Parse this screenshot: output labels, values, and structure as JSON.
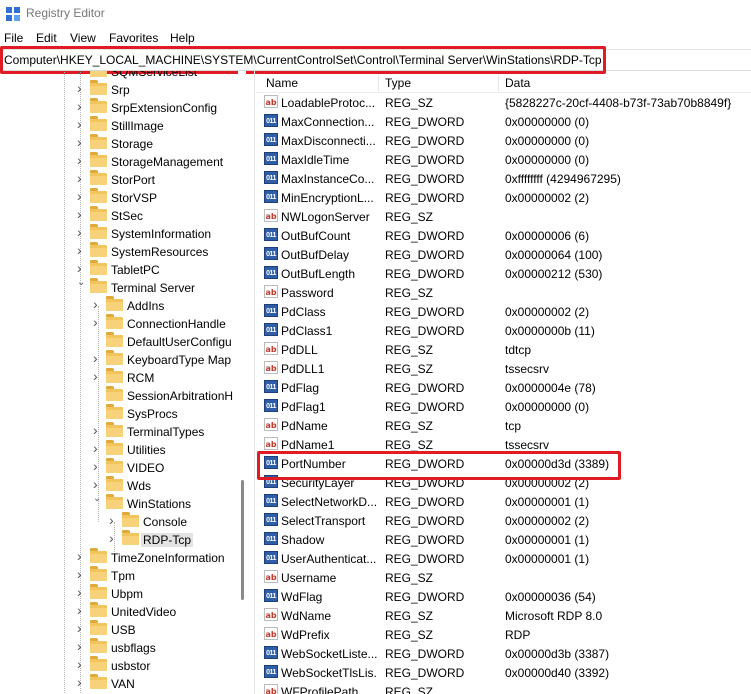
{
  "window": {
    "title": "Registry Editor"
  },
  "menu": [
    "File",
    "Edit",
    "View",
    "Favorites",
    "Help"
  ],
  "address": "Computer\\HKEY_LOCAL_MACHINE\\SYSTEM\\CurrentControlSet\\Control\\Terminal Server\\WinStations\\RDP-Tcp",
  "columns": {
    "name": "Name",
    "type": "Type",
    "data": "Data"
  },
  "tree": [
    {
      "label": "SQMServiceList",
      "level": 1,
      "expanded": false
    },
    {
      "label": "Srp",
      "level": 1,
      "expanded": false
    },
    {
      "label": "SrpExtensionConfig",
      "level": 1,
      "expanded": false
    },
    {
      "label": "StillImage",
      "level": 1,
      "expanded": false
    },
    {
      "label": "Storage",
      "level": 1,
      "expanded": false
    },
    {
      "label": "StorageManagement",
      "level": 1,
      "expanded": false
    },
    {
      "label": "StorPort",
      "level": 1,
      "expanded": false
    },
    {
      "label": "StorVSP",
      "level": 1,
      "expanded": false
    },
    {
      "label": "StSec",
      "level": 1,
      "expanded": false
    },
    {
      "label": "SystemInformation",
      "level": 1,
      "expanded": false
    },
    {
      "label": "SystemResources",
      "level": 1,
      "expanded": false
    },
    {
      "label": "TabletPC",
      "level": 1,
      "expanded": false
    },
    {
      "label": "Terminal Server",
      "level": 1,
      "expanded": true
    },
    {
      "label": "AddIns",
      "level": 2,
      "expanded": false
    },
    {
      "label": "ConnectionHandle",
      "level": 2,
      "expanded": false
    },
    {
      "label": "DefaultUserConfigu",
      "level": 2,
      "expanded": false,
      "leaf": true
    },
    {
      "label": "KeyboardType Map",
      "level": 2,
      "expanded": false
    },
    {
      "label": "RCM",
      "level": 2,
      "expanded": false
    },
    {
      "label": "SessionArbitrationH",
      "level": 2,
      "expanded": false,
      "leaf": true
    },
    {
      "label": "SysProcs",
      "level": 2,
      "expanded": false,
      "leaf": true
    },
    {
      "label": "TerminalTypes",
      "level": 2,
      "expanded": false
    },
    {
      "label": "Utilities",
      "level": 2,
      "expanded": false
    },
    {
      "label": "VIDEO",
      "level": 2,
      "expanded": false
    },
    {
      "label": "Wds",
      "level": 2,
      "expanded": false
    },
    {
      "label": "WinStations",
      "level": 2,
      "expanded": true
    },
    {
      "label": "Console",
      "level": 3,
      "expanded": false
    },
    {
      "label": "RDP-Tcp",
      "level": 3,
      "expanded": false,
      "selected": true
    },
    {
      "label": "TimeZoneInformation",
      "level": 1,
      "expanded": false
    },
    {
      "label": "Tpm",
      "level": 1,
      "expanded": false
    },
    {
      "label": "Ubpm",
      "level": 1,
      "expanded": false
    },
    {
      "label": "UnitedVideo",
      "level": 1,
      "expanded": false
    },
    {
      "label": "USB",
      "level": 1,
      "expanded": false
    },
    {
      "label": "usbflags",
      "level": 1,
      "expanded": false
    },
    {
      "label": "usbstor",
      "level": 1,
      "expanded": false
    },
    {
      "label": "VAN",
      "level": 1,
      "expanded": false
    }
  ],
  "values": [
    {
      "name": "LoadableProtoc...",
      "type": "REG_SZ",
      "data": "{5828227c-20cf-4408-b73f-73ab70b8849f}"
    },
    {
      "name": "MaxConnection...",
      "type": "REG_DWORD",
      "data": "0x00000000 (0)"
    },
    {
      "name": "MaxDisconnecti...",
      "type": "REG_DWORD",
      "data": "0x00000000 (0)"
    },
    {
      "name": "MaxIdleTime",
      "type": "REG_DWORD",
      "data": "0x00000000 (0)"
    },
    {
      "name": "MaxInstanceCo...",
      "type": "REG_DWORD",
      "data": "0xffffffff (4294967295)"
    },
    {
      "name": "MinEncryptionL...",
      "type": "REG_DWORD",
      "data": "0x00000002 (2)"
    },
    {
      "name": "NWLogonServer",
      "type": "REG_SZ",
      "data": ""
    },
    {
      "name": "OutBufCount",
      "type": "REG_DWORD",
      "data": "0x00000006 (6)"
    },
    {
      "name": "OutBufDelay",
      "type": "REG_DWORD",
      "data": "0x00000064 (100)"
    },
    {
      "name": "OutBufLength",
      "type": "REG_DWORD",
      "data": "0x00000212 (530)"
    },
    {
      "name": "Password",
      "type": "REG_SZ",
      "data": ""
    },
    {
      "name": "PdClass",
      "type": "REG_DWORD",
      "data": "0x00000002 (2)"
    },
    {
      "name": "PdClass1",
      "type": "REG_DWORD",
      "data": "0x0000000b (11)"
    },
    {
      "name": "PdDLL",
      "type": "REG_SZ",
      "data": "tdtcp"
    },
    {
      "name": "PdDLL1",
      "type": "REG_SZ",
      "data": "tssecsrv"
    },
    {
      "name": "PdFlag",
      "type": "REG_DWORD",
      "data": "0x0000004e (78)"
    },
    {
      "name": "PdFlag1",
      "type": "REG_DWORD",
      "data": "0x00000000 (0)"
    },
    {
      "name": "PdName",
      "type": "REG_SZ",
      "data": "tcp"
    },
    {
      "name": "PdName1",
      "type": "REG_SZ",
      "data": "tssecsrv"
    },
    {
      "name": "PortNumber",
      "type": "REG_DWORD",
      "data": "0x00000d3d (3389)",
      "highlighted": true
    },
    {
      "name": "SecurityLayer",
      "type": "REG_DWORD",
      "data": "0x00000002 (2)"
    },
    {
      "name": "SelectNetworkD...",
      "type": "REG_DWORD",
      "data": "0x00000001 (1)"
    },
    {
      "name": "SelectTransport",
      "type": "REG_DWORD",
      "data": "0x00000002 (2)"
    },
    {
      "name": "Shadow",
      "type": "REG_DWORD",
      "data": "0x00000001 (1)"
    },
    {
      "name": "UserAuthenticat...",
      "type": "REG_DWORD",
      "data": "0x00000001 (1)"
    },
    {
      "name": "Username",
      "type": "REG_SZ",
      "data": ""
    },
    {
      "name": "WdFlag",
      "type": "REG_DWORD",
      "data": "0x00000036 (54)"
    },
    {
      "name": "WdName",
      "type": "REG_SZ",
      "data": "Microsoft RDP 8.0"
    },
    {
      "name": "WdPrefix",
      "type": "REG_SZ",
      "data": "RDP"
    },
    {
      "name": "WebSocketListe...",
      "type": "REG_DWORD",
      "data": "0x00000d3b (3387)"
    },
    {
      "name": "WebSocketTlsLis...",
      "type": "REG_DWORD",
      "data": "0x00000d40 (3392)"
    },
    {
      "name": "WFProfilePath",
      "type": "REG_SZ",
      "data": ""
    }
  ],
  "colors": {
    "highlight": "#e01b24",
    "folder": "#f2c55c",
    "dword_icon": "#2f5ea8",
    "sz_icon": "#c0392b"
  },
  "icons": {
    "string_value": "ab",
    "dword_value": "011"
  }
}
